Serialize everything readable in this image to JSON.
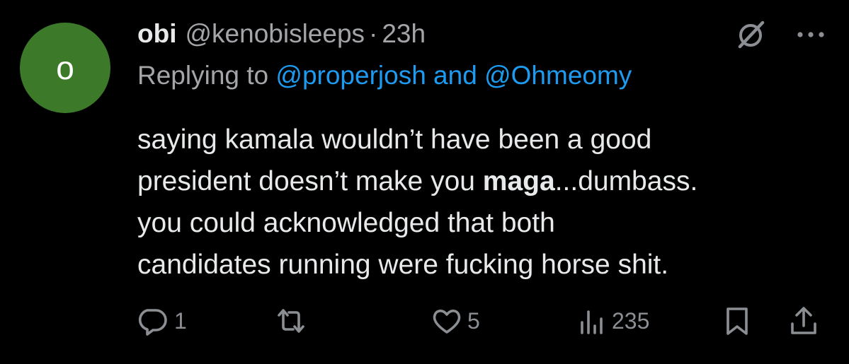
{
  "author": {
    "avatar_letter": "o",
    "avatar_color": "#3c7a2a",
    "display_name": "obi",
    "handle": "@kenobisleeps",
    "separator": "·",
    "time": "23h"
  },
  "reply": {
    "prefix": "Replying to ",
    "mention_1": "@properjosh",
    "connector": " and ",
    "mention_2": "@Ohmeomy"
  },
  "body": {
    "line1": "saying kamala wouldn’t have been a good",
    "line2_pre": "president doesn’t make you ",
    "line2_bold": "maga",
    "line2_post": "...dumbass.",
    "line3": "you could acknowledged that both",
    "line4": "candidates running were fucking horse shit."
  },
  "actions": {
    "replies": "1",
    "likes": "5",
    "views": "235"
  },
  "colors": {
    "background": "#000000",
    "text": "#e7e9ea",
    "secondary": "#a3a5a8",
    "link": "#1d9bf0",
    "icon": "#8b8f93"
  },
  "icons": {
    "top": [
      "grok-icon",
      "more-icon"
    ],
    "actions": [
      "reply-icon",
      "retweet-icon",
      "like-icon",
      "views-icon",
      "bookmark-icon",
      "share-icon"
    ]
  }
}
